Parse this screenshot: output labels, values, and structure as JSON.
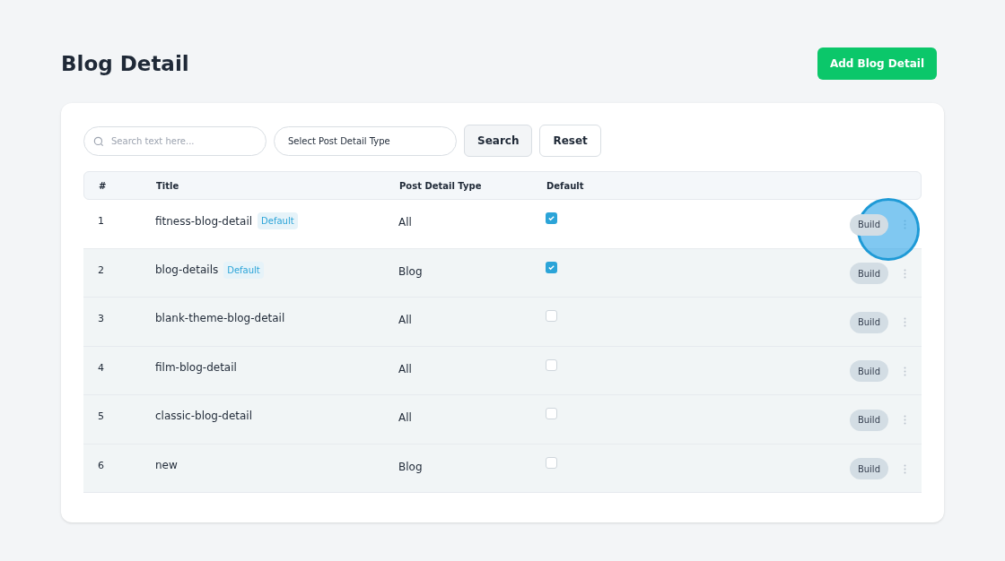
{
  "page_title": "Blog Detail",
  "add_button": "Add Blog Detail",
  "search": {
    "placeholder": "Search text here..."
  },
  "type_select": {
    "value": "Select Post Detail Type"
  },
  "search_button": "Search",
  "reset_button": "Reset",
  "columns": [
    "#",
    "Title",
    "Post Detail Type",
    "Default"
  ],
  "rows": [
    {
      "index": "1",
      "title": "fitness-blog-detail",
      "badge": "Default",
      "type": "All",
      "checked": true,
      "highlighted": true,
      "action": "Build"
    },
    {
      "index": "2",
      "title": "blog-details",
      "badge": "Default",
      "type": "Blog",
      "checked": true,
      "highlighted": false,
      "action": "Build"
    },
    {
      "index": "3",
      "title": "blank-theme-blog-detail",
      "type": "All",
      "checked": false,
      "highlighted": false,
      "action": "Build"
    },
    {
      "index": "4",
      "title": "film-blog-detail",
      "type": "All",
      "checked": false,
      "highlighted": false,
      "action": "Build"
    },
    {
      "index": "5",
      "title": "classic-blog-detail",
      "type": "All",
      "checked": false,
      "highlighted": false,
      "action": "Build"
    },
    {
      "index": "6",
      "title": "new",
      "type": "Blog",
      "checked": false,
      "highlighted": false,
      "action": "Build"
    }
  ]
}
